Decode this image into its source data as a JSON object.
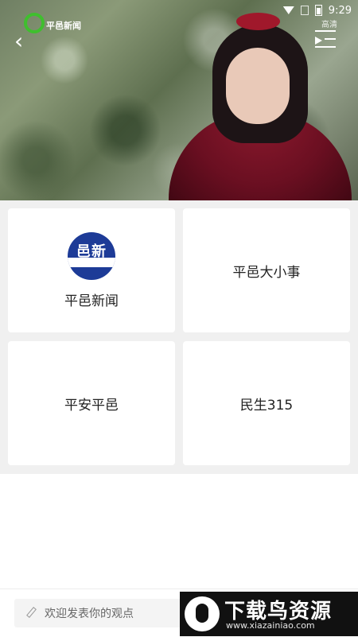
{
  "status_bar": {
    "time": "9:29"
  },
  "video": {
    "logo_text": "平邑新闻",
    "playlist_label": "高清"
  },
  "grid": {
    "items": [
      {
        "label": "平邑新闻",
        "icon": "news-logo-icon",
        "icon_text": "邑新"
      },
      {
        "label": "平邑大小事"
      },
      {
        "label": "平安平邑"
      },
      {
        "label": "民生315"
      }
    ]
  },
  "comment": {
    "placeholder": "欢迎发表你的观点"
  },
  "watermark": {
    "title": "下载鸟资源",
    "url": "www.xiazainiao.com"
  },
  "colors": {
    "brand_green": "#3fbf2e",
    "grid_bg": "#f0f0f0",
    "news_blue": "#1d3b97"
  }
}
